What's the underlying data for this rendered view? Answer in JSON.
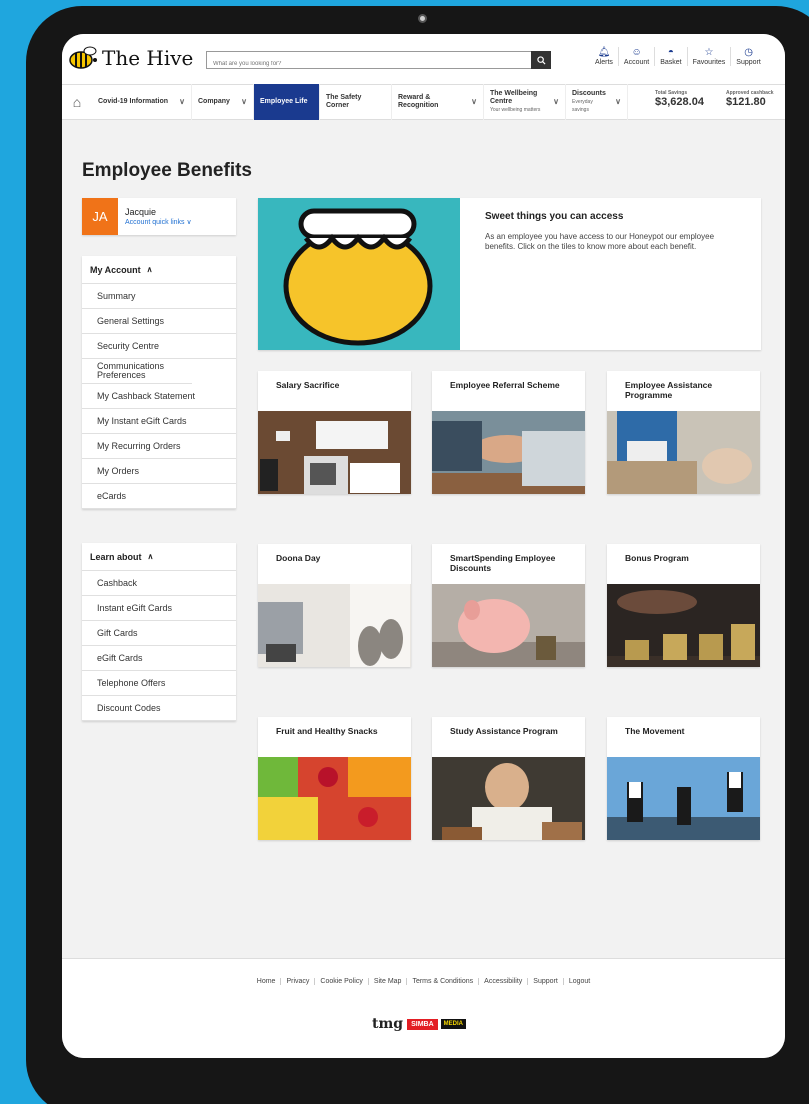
{
  "header": {
    "brand": "The Hive",
    "search_placeholder": "What are you looking for?",
    "icons": [
      {
        "label": "Alerts",
        "icon": "bell-icon"
      },
      {
        "label": "Account",
        "icon": "user-icon"
      },
      {
        "label": "Basket",
        "icon": "basket-icon"
      },
      {
        "label": "Favourites",
        "icon": "star-icon"
      },
      {
        "label": "Support",
        "icon": "support-icon"
      }
    ]
  },
  "nav": {
    "items": [
      "Covid-19 Information",
      "Company",
      "Employee Life",
      "The Safety Corner",
      "Reward & Recognition"
    ],
    "wellbeing": {
      "title": "The Wellbeing Centre",
      "sub": "Your wellbeing matters"
    },
    "discounts": {
      "title": "Discounts",
      "sub": "Everyday savings"
    },
    "savings": {
      "label": "Total Savings",
      "value": "$3,628.04"
    },
    "cashback": {
      "label": "Approved cashback",
      "value": "$121.80"
    }
  },
  "page": {
    "title": "Employee Benefits"
  },
  "user": {
    "initials": "JA",
    "name": "Jacquie",
    "quick_links": "Account quick links"
  },
  "account_menu": {
    "title": "My Account",
    "items": [
      "Summary",
      "General Settings",
      "Security Centre",
      "Communications Preferences",
      "My Cashback Statement",
      "My Instant eGift Cards",
      "My Recurring Orders",
      "My Orders",
      "eCards"
    ]
  },
  "learn_menu": {
    "title": "Learn about",
    "items": [
      "Cashback",
      "Instant eGift Cards",
      "Gift Cards",
      "eGift Cards",
      "Telephone Offers",
      "Discount Codes"
    ]
  },
  "hero": {
    "title": "Sweet things you can access",
    "text": "As an employee you have access to our Honeypot our employee benefits. Click on the tiles to know more about each benefit."
  },
  "tiles": [
    "Salary Sacrifice",
    "Employee Referral Scheme",
    "Employee Assistance Programme",
    "Doona Day",
    "SmartSpending Employee Discounts",
    "Bonus Program",
    "Fruit and Healthy Snacks",
    "Study Assistance Program",
    "The Movement"
  ],
  "footer": {
    "links": [
      "Home",
      "Privacy",
      "Cookie Policy",
      "Site Map",
      "Terms & Conditions",
      "Accessibility",
      "Support",
      "Logout"
    ],
    "logos": [
      "tmg",
      "SIMBA",
      "MEDIA"
    ]
  }
}
